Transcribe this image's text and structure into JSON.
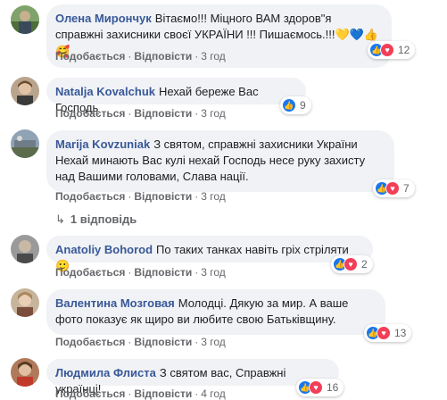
{
  "actions": {
    "like_label": "Подобається",
    "reply_label": "Відповісти"
  },
  "comments": [
    {
      "author": "Олена Мирончук",
      "text": "Вітаємо!!! Міцного ВАМ здоров\"я справжні захисники своєї УКРАЇНИ !!! Пишаємось.!!!",
      "emojis": "💛💙👍🥰",
      "time": "3 год",
      "reaction_count": "12"
    },
    {
      "author": "Natalja Kovalchuk",
      "text": "Нехай береже Вас Господь",
      "time": "3 год",
      "reaction_count": "9"
    },
    {
      "author": "Marija Kovzuniak",
      "text": "З святом, справжні захисники України Нехай минають Вас кулі нехай Господь несе руку захисту над Вашими головами, Слава нації.",
      "time": "3 год",
      "reaction_count": "7",
      "replies_label": "1 відповідь"
    },
    {
      "author": "Anatoliy Bohorod",
      "text": "По таких танках навіть гріх стріляти",
      "emojis": "🙂",
      "time": "3 год",
      "reaction_count": "2"
    },
    {
      "author": "Валентина Мозговая",
      "text": "Молодці. Дякую за мир. А ваше фото показує як щиро ви любите свою Батьківщину.",
      "time": "3 год",
      "reaction_count": "13"
    },
    {
      "author": "Людмила Флиста",
      "text": "З святом вас, Справжні українці!",
      "time": "4 год",
      "reaction_count": "16"
    }
  ],
  "colors": {
    "author": "#385898",
    "like": "#1877f2",
    "love": "#f33e58",
    "bubble": "#f0f2f5"
  }
}
